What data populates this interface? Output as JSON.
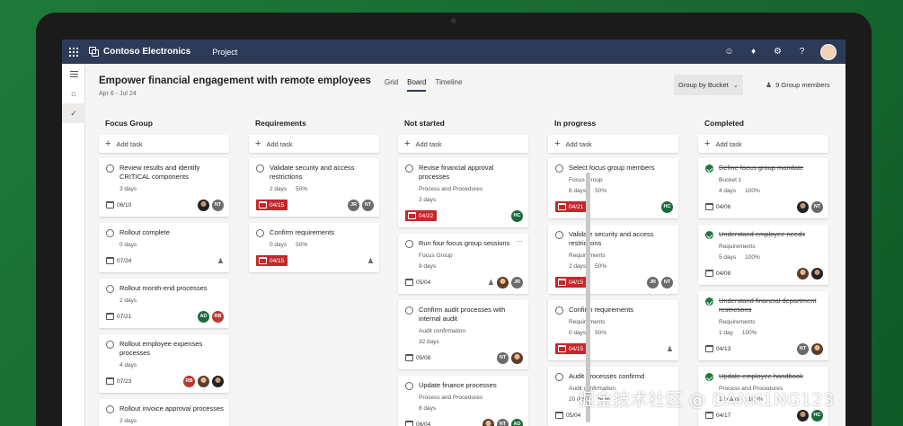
{
  "app": {
    "brand": "Contoso Electronics",
    "nav": "Project"
  },
  "header": {
    "title": "Empower financial engagement with remote employees",
    "dates": "Apr 6 - Jul 24",
    "tabs": [
      {
        "label": "Grid",
        "active": false
      },
      {
        "label": "Board",
        "active": true
      },
      {
        "label": "Timeline",
        "active": false
      }
    ],
    "group_by": "Group by Bucket",
    "members": "9 Group members"
  },
  "add_task_label": "Add task",
  "columns": [
    {
      "title": "Focus Group",
      "cards": [
        {
          "title": "Review results and identify CRITICAL components",
          "meta": [
            "3 days"
          ],
          "date": "06/10",
          "late": false,
          "avatars": [
            "dark",
            "NT"
          ]
        },
        {
          "title": "Rollout complete",
          "meta": [
            "0 days"
          ],
          "date": "07/24",
          "late": false,
          "avatars": [],
          "assign": true
        },
        {
          "title": "Rollout month-end processes",
          "meta": [
            "2 days"
          ],
          "date": "07/21",
          "late": false,
          "avatars": [
            "AD",
            "RB"
          ]
        },
        {
          "title": "Rollout employee expenses processes",
          "meta": [
            "4 days"
          ],
          "date": "07/23",
          "late": false,
          "avatars": [
            "RB",
            "photo",
            "dark"
          ]
        },
        {
          "title": "Rollout invoice approval processes",
          "meta": [
            "2 days"
          ],
          "date": "",
          "late": false,
          "avatars": []
        }
      ]
    },
    {
      "title": "Requirements",
      "cards": [
        {
          "title": "Validate security and access restrictions",
          "meta": [
            "2 days",
            "50%"
          ],
          "date": "04/15",
          "late": true,
          "avatars": [
            "JR",
            "NT"
          ]
        },
        {
          "title": "Confirm requirements",
          "meta": [
            "0 days",
            "50%"
          ],
          "date": "04/15",
          "late": true,
          "avatars": [],
          "assign": true
        }
      ]
    },
    {
      "title": "Not started",
      "cards": [
        {
          "title": "Revise financial approval processes",
          "bucket": "Process and Procedures",
          "meta": [
            "3 days"
          ],
          "date": "04/22",
          "late": true,
          "avatars": [
            "HC"
          ]
        },
        {
          "title": "Run four focus group sessions",
          "bucket": "Focus Group",
          "meta": [
            "9 days"
          ],
          "date": "05/04",
          "late": false,
          "avatars": [
            "photo",
            "JR"
          ],
          "assign": true,
          "more": "···"
        },
        {
          "title": "Confirm audit processes with internal audit",
          "bucket": "Audit confirmation",
          "meta": [
            "32 days"
          ],
          "date": "05/08",
          "late": false,
          "avatars": [
            "NT",
            "photo"
          ]
        },
        {
          "title": "Update finance processes",
          "bucket": "Process and Procedures",
          "meta": [
            "8 days"
          ],
          "date": "06/04",
          "late": false,
          "avatars": [
            "photo",
            "NT",
            "AD"
          ]
        }
      ]
    },
    {
      "title": "In progress",
      "cards": [
        {
          "title": "Select focus group members",
          "bucket": "Focus Group",
          "meta": [
            "8 days",
            "50%"
          ],
          "date": "04/21",
          "late": true,
          "avatars": [
            "HC"
          ]
        },
        {
          "title": "Validate security and access restrictions",
          "bucket": "Requirements",
          "meta": [
            "2 days",
            "50%"
          ],
          "date": "04/15",
          "late": true,
          "avatars": [
            "JR",
            "NT"
          ]
        },
        {
          "title": "Confirm requirements",
          "bucket": "Requirements",
          "meta": [
            "0 days",
            "50%"
          ],
          "date": "04/15",
          "late": true,
          "avatars": [],
          "assign": true
        },
        {
          "title": "Audit processes confirmd",
          "bucket": "Audit confirmation",
          "meta": [
            "20 days",
            "50%"
          ],
          "date": "05/04",
          "late": false,
          "avatars": []
        }
      ]
    },
    {
      "title": "Completed",
      "cards": [
        {
          "title": "Define focus group mandate",
          "bucket": "Bucket 1",
          "meta": [
            "4 days",
            "100%"
          ],
          "date": "04/06",
          "late": false,
          "done": true,
          "avatars": [
            "dark",
            "NT"
          ]
        },
        {
          "title": "Understand employee needs",
          "bucket": "Requirements",
          "meta": [
            "5 days",
            "100%"
          ],
          "date": "04/08",
          "late": false,
          "done": true,
          "avatars": [
            "photo",
            "dark"
          ]
        },
        {
          "title": "Understand financial department restrictions",
          "bucket": "Requirements",
          "meta": [
            "1 day",
            "100%"
          ],
          "date": "04/13",
          "late": false,
          "done": true,
          "avatars": [
            "NT",
            "photo"
          ]
        },
        {
          "title": "Update employee handbook",
          "bucket": "Process and Procedures",
          "meta": [
            "12 days",
            "100%"
          ],
          "date": "04/17",
          "late": false,
          "done": true,
          "avatars": [
            "dark",
            "HC"
          ]
        }
      ]
    }
  ],
  "watermark": "掘金技术社区 @ DANK1NG123",
  "colors": {
    "topbar": "#2d3b59",
    "late": "#c4282c",
    "done": "#1e7a3c",
    "background": "#1f7a3a"
  }
}
